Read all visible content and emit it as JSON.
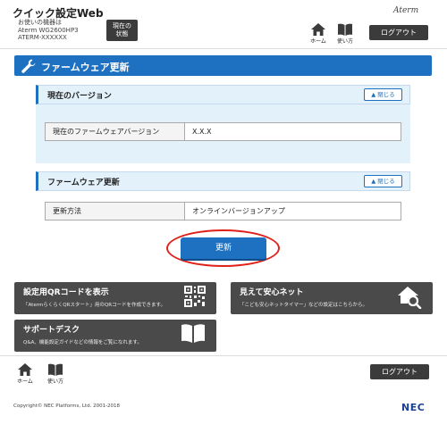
{
  "header": {
    "app_title": "クイック設定Web",
    "device_label": "お使いの機器は",
    "device_model": "Aterm WG2600HP3",
    "device_id": "ATERM-XXXXXX",
    "status_line1": "現在の",
    "status_line2": "状態",
    "brand": "Aterm",
    "home_label": "ホーム",
    "help_label": "使い方",
    "logout_label": "ログアウト"
  },
  "page": {
    "title": "ファームウェア更新"
  },
  "sections": {
    "current_version": {
      "title": "現在のバージョン",
      "close_label": "閉じる",
      "row_label": "現在のファームウェアバージョン",
      "row_value": "X.X.X"
    },
    "firmware_update": {
      "title": "ファームウェア更新",
      "close_label": "閉じる",
      "row_label": "更新方法",
      "row_value": "オンラインバージョンアップ"
    }
  },
  "actions": {
    "update_label": "更新"
  },
  "tiles": {
    "qr": {
      "title": "設定用QRコードを表示",
      "desc": "「AtermらくらくQRスタート」用のQRコードを作成できます。"
    },
    "safety": {
      "title": "見えて安心ネット",
      "desc": "「こども安心ネットタイマー」などの設定はこちらから。"
    },
    "support": {
      "title": "サポートデスク",
      "desc": "Q&A、機能設定ガイドなどの情報をご覧になれます。"
    }
  },
  "footer": {
    "home_label": "ホーム",
    "help_label": "使い方",
    "logout_label": "ログアウト",
    "copyright": "Copyright© NEC Platforms, Ltd. 2001-2018",
    "vendor_logo": "NEC"
  },
  "colors": {
    "accent": "#1e70c0",
    "section_bg": "#e3f1fb",
    "dark_button": "#3b3b3b",
    "tile_bg": "#4a4a4a",
    "highlight": "#e0201a"
  },
  "icons": {
    "home": "home-icon",
    "help": "book-icon",
    "wrench": "wrench-icon",
    "qr": "qr-code-icon",
    "safety": "house-search-icon",
    "support": "book-icon"
  }
}
